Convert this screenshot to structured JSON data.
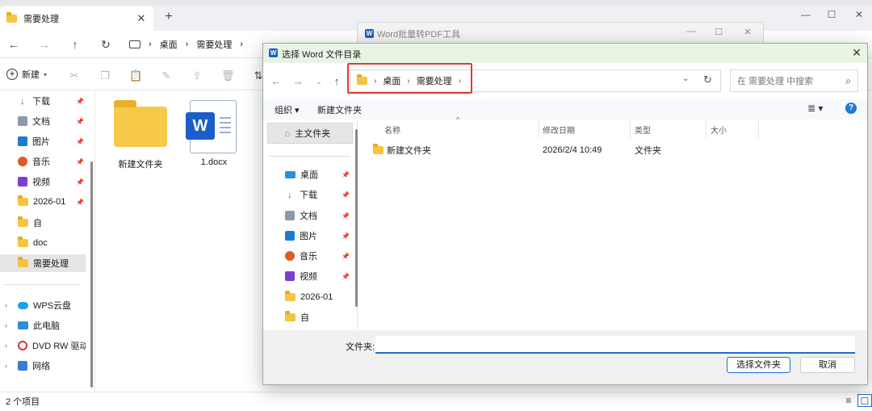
{
  "explorer": {
    "tab_title": "需要处理",
    "breadcrumb": [
      "桌面",
      "需要处理"
    ],
    "new_label": "新建",
    "sidebar": {
      "pinned": [
        {
          "label": "下载",
          "icon": "download-icon"
        },
        {
          "label": "文档",
          "icon": "document-icon"
        },
        {
          "label": "图片",
          "icon": "pictures-icon"
        },
        {
          "label": "音乐",
          "icon": "music-icon"
        },
        {
          "label": "视频",
          "icon": "video-icon"
        },
        {
          "label": "2026-01",
          "icon": "folder-icon"
        }
      ],
      "folders": [
        {
          "label": "自",
          "icon": "folder-icon"
        },
        {
          "label": "doc",
          "icon": "folder-icon"
        },
        {
          "label": "需要处理",
          "icon": "folder-icon",
          "selected": true
        }
      ],
      "roots": [
        {
          "label": "WPS云盘",
          "icon": "cloud-icon"
        },
        {
          "label": "此电脑",
          "icon": "computer-icon"
        },
        {
          "label": "DVD RW 驱动器",
          "icon": "dvd-icon"
        },
        {
          "label": "网络",
          "icon": "network-icon"
        }
      ]
    },
    "items": [
      {
        "label": "新建文件夹",
        "type": "folder"
      },
      {
        "label": "1.docx",
        "type": "word"
      }
    ],
    "status": "2 个项目"
  },
  "tool_window": {
    "title": "Word批量转PDF工具"
  },
  "dialog": {
    "title": "选择 Word 文件目录",
    "address": [
      "桌面",
      "需要处理"
    ],
    "search_placeholder": "在 需要处理 中搜索",
    "organize_label": "组织 ▾",
    "new_folder_label": "新建文件夹",
    "home_label": "主文件夹",
    "nav_items": [
      {
        "label": "桌面",
        "icon": "desktop-icon"
      },
      {
        "label": "下载",
        "icon": "download-icon"
      },
      {
        "label": "文档",
        "icon": "document-icon"
      },
      {
        "label": "图片",
        "icon": "pictures-icon"
      },
      {
        "label": "音乐",
        "icon": "music-icon"
      },
      {
        "label": "视频",
        "icon": "video-icon"
      },
      {
        "label": "2026-01",
        "icon": "folder-icon"
      },
      {
        "label": "自",
        "icon": "folder-icon"
      }
    ],
    "columns": [
      "名称",
      "修改日期",
      "类型",
      "大小"
    ],
    "files": [
      {
        "name": "新建文件夹",
        "date": "2026/2/4 10:49",
        "type": "文件夹",
        "size": ""
      }
    ],
    "filename_label": "文件夹:",
    "filename_value": "",
    "select_button": "选择文件夹",
    "cancel_button": "取消"
  },
  "colors": {
    "accent": "#1c6fd1",
    "highlight_box": "#e53935",
    "dialog_titlebar": "#e8f5e4",
    "folder": "#f7c948"
  }
}
